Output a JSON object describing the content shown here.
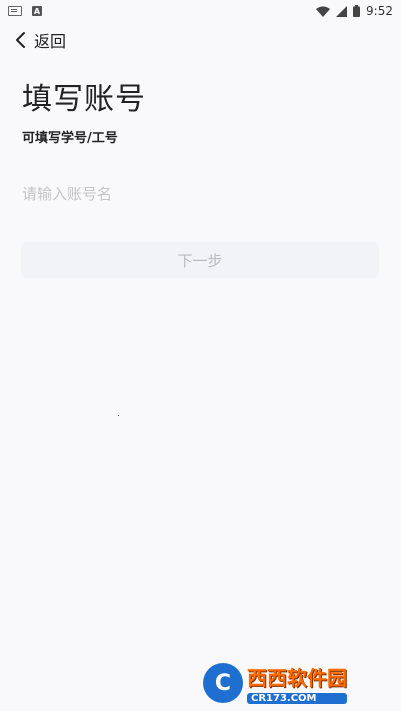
{
  "status_bar": {
    "time": "9:52",
    "left_icons": [
      "keyboard-icon",
      "a-icon"
    ],
    "right_icons": [
      "wifi-icon",
      "signal-icon",
      "battery-icon"
    ],
    "a_icon_text": "A"
  },
  "header": {
    "back_label": "返回"
  },
  "main": {
    "title": "填写账号",
    "subtitle": "可填写学号/工号",
    "account_input": {
      "value": "",
      "placeholder": "请输入账号名"
    },
    "next_button_label": "下一步"
  },
  "watermark": {
    "brand_text": "西西软件园",
    "domain": "CR173.COM",
    "badge_letter": "C"
  },
  "colors": {
    "background": "#f9f9fb",
    "button_bg": "#f2f3f6",
    "button_text": "#b9bbc0",
    "placeholder": "#c4c4c8"
  }
}
